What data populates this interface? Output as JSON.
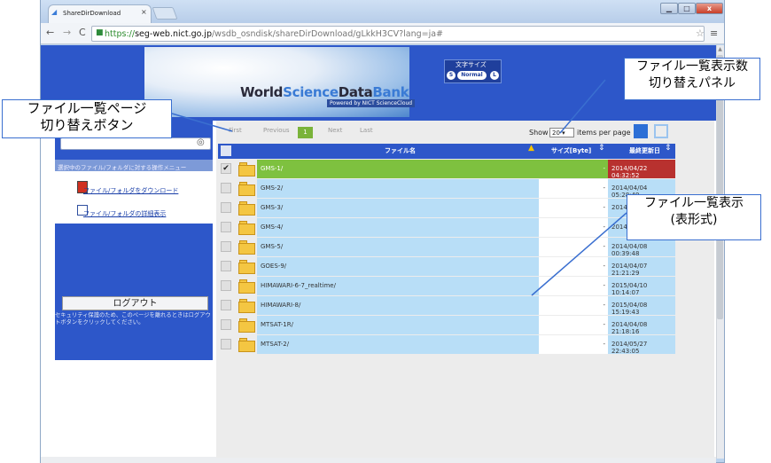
{
  "browser": {
    "tab_title": "ShareDirDownload",
    "tab_close": "×",
    "url_scheme": "https://",
    "url_host": "seg-web.nict.go.jp",
    "url_path": "/wsdb_osndisk/shareDirDownload/gLkkH3CV?lang=ja#",
    "back": "←",
    "forward": "→",
    "reload": "C",
    "star": "☆",
    "menu": "≡",
    "minimize": "▁",
    "maximize": "□",
    "close": "x"
  },
  "banner": {
    "title_a": "World",
    "title_b": "Science",
    "title_c": "Data",
    "title_d": "Bank",
    "subtitle": "Powered by NICT ScienceCloud"
  },
  "font_size_panel": {
    "label": "文字サイズ",
    "small": "S",
    "normal": "Normal",
    "large": "L"
  },
  "sidebar": {
    "menu_title": "選択中のファイル/フォルダに対する操作メニュー",
    "download_label": "ファイル/フォルダをダウンロード",
    "detail_label": "ファイル/フォルダの詳細表示",
    "logout_label": "ログアウト",
    "logout_note": "セキュリティ保護のため、このページを離れるときはログアウトボタンをクリックしてください。"
  },
  "pager": {
    "first": "First",
    "previous": "Previous",
    "current": "1",
    "next": "Next",
    "last": "Last",
    "show_label": "Show",
    "per_page_value": "20",
    "per_page_label": "items per page"
  },
  "table": {
    "headers": {
      "name": "ファイル名",
      "size": "サイズ[Byte]",
      "date": "最終更新日"
    },
    "rows": [
      {
        "name": "GMS-1/",
        "size": "-",
        "date": "2014/04/22 04:32:52",
        "selected": true
      },
      {
        "name": "GMS-2/",
        "size": "-",
        "date": "2014/04/04 05:28:49"
      },
      {
        "name": "GMS-3/",
        "size": "-",
        "date": "2014/"
      },
      {
        "name": "GMS-4/",
        "size": "-",
        "date": "2014/"
      },
      {
        "name": "GMS-5/",
        "size": "-",
        "date": "2014/04/08 00:39:48"
      },
      {
        "name": "GOES-9/",
        "size": "-",
        "date": "2014/04/07 21:21:29"
      },
      {
        "name": "HIMAWARI-6-7_realtime/",
        "size": "-",
        "date": "2015/04/10 10:14:07"
      },
      {
        "name": "HIMAWARI-8/",
        "size": "-",
        "date": "2015/04/08 15:19:43"
      },
      {
        "name": "MTSAT-1R/",
        "size": "-",
        "date": "2014/04/08 21:18:16"
      },
      {
        "name": "MTSAT-2/",
        "size": "-",
        "date": "2014/05/27 22:43:05"
      }
    ]
  },
  "callouts": {
    "pager_line1": "ファイル一覧ページ",
    "pager_line2": "切り替えボタン",
    "panel_line1": "ファイル一覧表示数",
    "panel_line2": "切り替えパネル",
    "list_line1": "ファイル一覧表示",
    "list_line2": "(表形式)"
  },
  "colors": {
    "header_blue": "#2d57c9",
    "row_light_blue": "#b8def7",
    "selected_green": "#7ec13f",
    "callout_border": "#3a6fd0"
  }
}
